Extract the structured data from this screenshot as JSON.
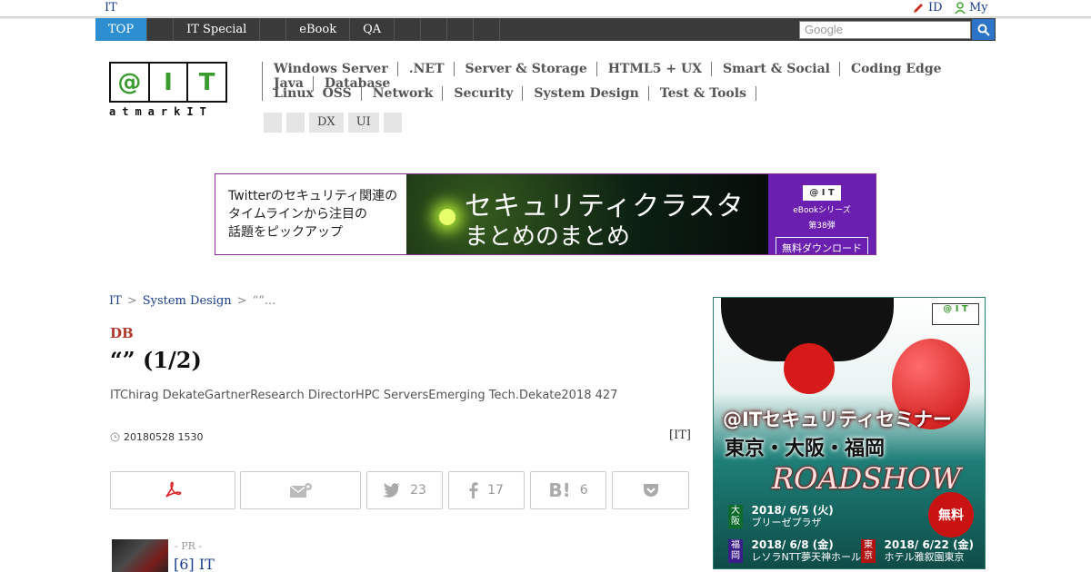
{
  "topbar": {
    "site_label": "IT",
    "id_label": "ID",
    "my_label": "My"
  },
  "nav": {
    "items": [
      {
        "label": "TOP"
      },
      {
        "label": ""
      },
      {
        "label": "IT Special"
      },
      {
        "label": ""
      },
      {
        "label": "eBook"
      },
      {
        "label": "QA"
      },
      {
        "label": ""
      },
      {
        "label": ""
      },
      {
        "label": ""
      },
      {
        "label": ""
      }
    ],
    "search_placeholder": "Google"
  },
  "logo": {
    "cells": [
      "@",
      "I",
      "T"
    ],
    "wordmark": "atmarkIT"
  },
  "categories": {
    "row1": [
      "Windows Server",
      ".NET",
      "Server & Storage",
      "HTML5 + UX",
      "Smart & Social",
      "Coding Edge",
      "Java",
      "Database"
    ],
    "row2": [
      "Linux  OSS",
      "Network",
      "Security",
      "System Design",
      "Test & Tools"
    ],
    "tags": [
      "",
      "",
      "DX",
      "UI",
      ""
    ]
  },
  "banner": {
    "left_text": [
      "Twitterのセキュリティ関連の",
      "タイムラインから注目の",
      "話題をピックアップ"
    ],
    "title_1": "セキュリティクラスタ",
    "title_2": "まとめのまとめ",
    "badge": "@ I T",
    "series": "eBookシリーズ",
    "volume": "第38弾",
    "download": "無料ダウンロード"
  },
  "breadcrumb": {
    "home": "IT",
    "sep": ">",
    "section": "System Design",
    "current": "“”..."
  },
  "article": {
    "kicker": "DB",
    "title": "“” (1/2)",
    "summary": "ITChirag DekateGartnerResearch DirectorHPC ServersEmerging Tech.Dekate2018 427",
    "date": "20180528 1530",
    "source": "[IT]"
  },
  "share": {
    "twitter_count": "23",
    "facebook_count": "17",
    "hatena_count": "6"
  },
  "pr": {
    "label": "- PR -",
    "link": "[6] IT"
  },
  "sidebar_ad": {
    "badge": "@ I T",
    "headline": "@ITセキュリティセミナー",
    "cities": "東京・大阪・福岡",
    "roadshow": "ROADSHOW",
    "free": "無料",
    "events": [
      {
        "city": "大阪",
        "date": "2018/ 6/5 (火)",
        "venue": "ブリーゼプラザ"
      },
      {
        "city": "福岡",
        "date": "2018/ 6/8 (金)",
        "venue": "レソラNTT夢天神ホール"
      },
      {
        "city": "東京",
        "date": "2018/ 6/22 (金)",
        "venue": "ホテル雅叙園東京"
      }
    ]
  },
  "colors": {
    "nav_bg": "#3a3a3a",
    "nav_active": "#2d8fd0",
    "link": "#1a3e8c",
    "kicker": "#b03a2e",
    "logo_green": "#3a9b2f"
  }
}
